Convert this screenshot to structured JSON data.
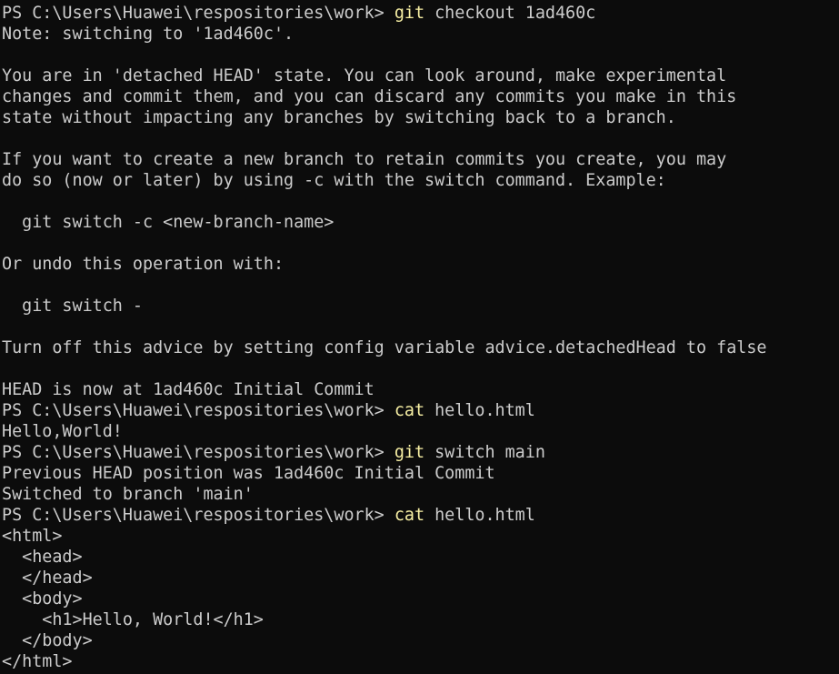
{
  "terminal": {
    "colors": {
      "background": "#0c0c0c",
      "text": "#cccccc",
      "command": "#f9f1a5"
    },
    "lines": [
      {
        "type": "prompt",
        "prompt": "PS C:\\Users\\Huawei\\respositories\\work> ",
        "cmd": "git",
        "args": " checkout 1ad460c"
      },
      {
        "type": "text",
        "text": "Note: switching to '1ad460c'."
      },
      {
        "type": "text",
        "text": ""
      },
      {
        "type": "text",
        "text": "You are in 'detached HEAD' state. You can look around, make experimental"
      },
      {
        "type": "text",
        "text": "changes and commit them, and you can discard any commits you make in this"
      },
      {
        "type": "text",
        "text": "state without impacting any branches by switching back to a branch."
      },
      {
        "type": "text",
        "text": ""
      },
      {
        "type": "text",
        "text": "If you want to create a new branch to retain commits you create, you may"
      },
      {
        "type": "text",
        "text": "do so (now or later) by using -c with the switch command. Example:"
      },
      {
        "type": "text",
        "text": ""
      },
      {
        "type": "text",
        "text": "  git switch -c <new-branch-name>"
      },
      {
        "type": "text",
        "text": ""
      },
      {
        "type": "text",
        "text": "Or undo this operation with:"
      },
      {
        "type": "text",
        "text": ""
      },
      {
        "type": "text",
        "text": "  git switch -"
      },
      {
        "type": "text",
        "text": ""
      },
      {
        "type": "text",
        "text": "Turn off this advice by setting config variable advice.detachedHead to false"
      },
      {
        "type": "text",
        "text": ""
      },
      {
        "type": "text",
        "text": "HEAD is now at 1ad460c Initial Commit"
      },
      {
        "type": "prompt",
        "prompt": "PS C:\\Users\\Huawei\\respositories\\work> ",
        "cmd": "cat",
        "args": " hello.html"
      },
      {
        "type": "text",
        "text": "Hello,World!"
      },
      {
        "type": "prompt",
        "prompt": "PS C:\\Users\\Huawei\\respositories\\work> ",
        "cmd": "git",
        "args": " switch main"
      },
      {
        "type": "text",
        "text": "Previous HEAD position was 1ad460c Initial Commit"
      },
      {
        "type": "text",
        "text": "Switched to branch 'main'"
      },
      {
        "type": "prompt",
        "prompt": "PS C:\\Users\\Huawei\\respositories\\work> ",
        "cmd": "cat",
        "args": " hello.html"
      },
      {
        "type": "text",
        "text": "<html>"
      },
      {
        "type": "text",
        "text": "  <head>"
      },
      {
        "type": "text",
        "text": "  </head>"
      },
      {
        "type": "text",
        "text": "  <body>"
      },
      {
        "type": "text",
        "text": "    <h1>Hello, World!</h1>"
      },
      {
        "type": "text",
        "text": "  </body>"
      },
      {
        "type": "text",
        "text": "</html>"
      }
    ]
  }
}
